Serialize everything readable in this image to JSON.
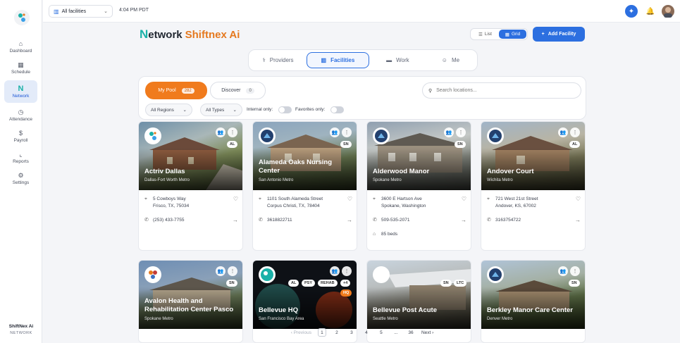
{
  "sidebar": {
    "items": [
      {
        "label": "Dashboard",
        "icon": "home-icon",
        "glyph": "⌂"
      },
      {
        "label": "Schedule",
        "icon": "calendar-icon",
        "glyph": "▦"
      },
      {
        "label": "Network",
        "icon": "network-icon",
        "glyph": "N"
      },
      {
        "label": "Attendance",
        "icon": "clock-icon",
        "glyph": "◷"
      },
      {
        "label": "Payroll",
        "icon": "dollar-icon",
        "glyph": "$"
      },
      {
        "label": "Reports",
        "icon": "chart-icon",
        "glyph": "⌞"
      },
      {
        "label": "Settings",
        "icon": "gear-icon",
        "glyph": "⚙"
      }
    ],
    "active": "Network",
    "footer_brand": "ShiftNex Ai",
    "footer_sub": "NETWORK"
  },
  "topbar": {
    "facility_select": "All facilities",
    "time": "4:04 PM PDT"
  },
  "header": {
    "logo_n": "N",
    "logo_rest": "etwork",
    "logo_brand": "Shiftnex Ai",
    "view_list": "List",
    "view_grid": "Grid",
    "add_button": "Add Facility"
  },
  "tabs": [
    {
      "label": "Providers",
      "glyph": "⚕"
    },
    {
      "label": "Facilities",
      "glyph": "▥"
    },
    {
      "label": "Work",
      "glyph": "▬"
    },
    {
      "label": "Me",
      "glyph": "☺"
    }
  ],
  "filters": {
    "my_pool_label": "My Pool",
    "my_pool_count": "282",
    "discover_label": "Discover",
    "discover_count": "0",
    "search_placeholder": "Search locations...",
    "regions": "All Regions",
    "types": "All Types",
    "internal_only": "Internal only:",
    "favorites_only": "Favorites only:"
  },
  "cards": [
    {
      "name": "Actriv Dallas",
      "metro": "Dallas-Fort Worth Metro",
      "badges": [
        "AL"
      ],
      "address1": "5 Cowboys Way",
      "address2": "Frisco, TX, 75034",
      "phone": "(253) 433-7755"
    },
    {
      "name": "Alameda Oaks Nursing Center",
      "metro": "San Antonio Metro",
      "badges": [
        "SN"
      ],
      "address1": "1101 South Alameda Street",
      "address2": "Corpus Christi, TX, 78404",
      "phone": "3618822711"
    },
    {
      "name": "Alderwood Manor",
      "metro": "Spokane Metro",
      "badges": [
        "SN"
      ],
      "address1": "3600 E Hartson Ave",
      "address2": "Spokane, Washington",
      "phone": "509-535-2071",
      "beds": "85 beds"
    },
    {
      "name": "Andover Court",
      "metro": "Wichita Metro",
      "badges": [
        "AL"
      ],
      "address1": "721 West 21st Street",
      "address2": "Andover, KS, 67002",
      "phone": "3163754722"
    },
    {
      "name": "Avalon Health and Rehabilitation Center Pasco",
      "metro": "Spokane Metro",
      "badges": [
        "SN"
      ]
    },
    {
      "name": "Bellevue HQ",
      "metro": "San Francisco Bay Area",
      "badges": [
        "AL",
        "PSY",
        "REHAB",
        "+4"
      ],
      "hq": "HQ"
    },
    {
      "name": "Bellevue Post Acute",
      "metro": "Seattle Metro",
      "badges": [
        "SN",
        "LTC"
      ]
    },
    {
      "name": "Berkley Manor Care Center",
      "metro": "Denver Metro",
      "badges": [
        "SN"
      ]
    }
  ],
  "pagination": {
    "previous": "‹ Previous",
    "pages": [
      "1",
      "2",
      "3",
      "4",
      "5",
      "...",
      "36"
    ],
    "next": "Next ›"
  },
  "colors": {
    "accent": "#2c6fe0",
    "pool_orange": "#f07b1d",
    "brand_teal": "#1bb1a8"
  }
}
